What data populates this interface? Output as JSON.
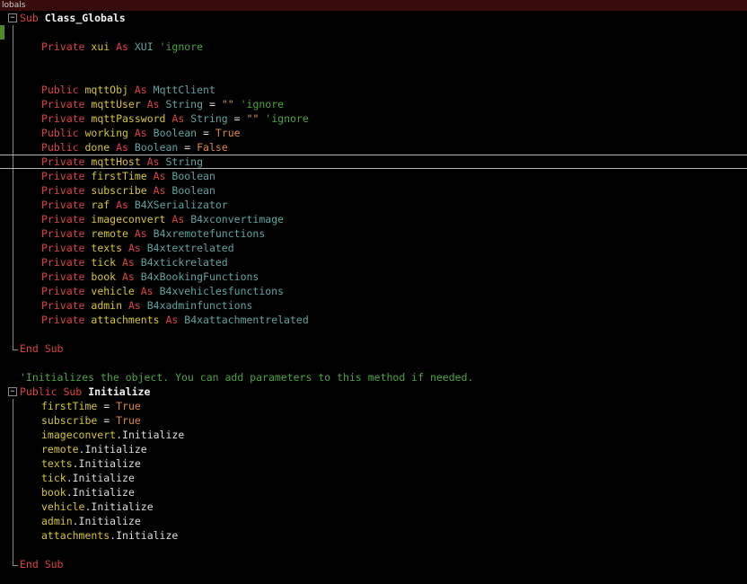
{
  "window": {
    "tab_label": "lobals"
  },
  "palette": {
    "bg": "#000000",
    "bar": "#3a0b0b",
    "bartext": "#cccccc",
    "kw": "#dd4242",
    "id": "#d6c42e",
    "type": "#5fa3a0",
    "cmt": "#4ea342",
    "str": "#d79a52",
    "val": "#d8873c",
    "txt": "#dcdcdc",
    "sub": "#f2f2f2",
    "guide": "#8a8a8a",
    "currentline": "#b5b5b5",
    "marker": "#4f8a26"
  },
  "icons": {
    "fold_collapse": "−"
  },
  "code": {
    "lines": [
      {
        "gutter": "fold",
        "indent": 0,
        "tokens": [
          [
            "kw",
            "Sub "
          ],
          [
            "sub",
            "Class_Globals"
          ]
        ]
      },
      {
        "gutter": "guide",
        "indent": 1,
        "marker": true,
        "tokens": []
      },
      {
        "gutter": "guide",
        "indent": 1,
        "tokens": [
          [
            "kw",
            "Private "
          ],
          [
            "id",
            "xui "
          ],
          [
            "kw",
            "As "
          ],
          [
            "type",
            "XUI "
          ],
          [
            "cmt",
            "'ignore"
          ]
        ]
      },
      {
        "gutter": "guide",
        "indent": 1,
        "tokens": []
      },
      {
        "gutter": "guide",
        "indent": 1,
        "tokens": []
      },
      {
        "gutter": "guide",
        "indent": 1,
        "tokens": [
          [
            "kw",
            "Public "
          ],
          [
            "id",
            "mqttObj "
          ],
          [
            "kw",
            "As "
          ],
          [
            "type",
            "MqttClient"
          ]
        ]
      },
      {
        "gutter": "guide",
        "indent": 1,
        "tokens": [
          [
            "kw",
            "Private "
          ],
          [
            "id",
            "mqttUser "
          ],
          [
            "kw",
            "As "
          ],
          [
            "type",
            "String "
          ],
          [
            "txt",
            "= "
          ],
          [
            "str",
            "\"\" "
          ],
          [
            "cmt",
            "'ignore"
          ]
        ]
      },
      {
        "gutter": "guide",
        "indent": 1,
        "tokens": [
          [
            "kw",
            "Private "
          ],
          [
            "id",
            "mqttPassword "
          ],
          [
            "kw",
            "As "
          ],
          [
            "type",
            "String "
          ],
          [
            "txt",
            "= "
          ],
          [
            "str",
            "\"\" "
          ],
          [
            "cmt",
            "'ignore"
          ]
        ]
      },
      {
        "gutter": "guide",
        "indent": 1,
        "tokens": [
          [
            "kw",
            "Public "
          ],
          [
            "id",
            "working "
          ],
          [
            "kw",
            "As "
          ],
          [
            "type",
            "Boolean "
          ],
          [
            "txt",
            "= "
          ],
          [
            "val",
            "True"
          ]
        ]
      },
      {
        "gutter": "guide",
        "indent": 1,
        "tokens": [
          [
            "kw",
            "Public "
          ],
          [
            "id",
            "done "
          ],
          [
            "kw",
            "As "
          ],
          [
            "type",
            "Boolean "
          ],
          [
            "txt",
            "= "
          ],
          [
            "val",
            "False"
          ]
        ]
      },
      {
        "gutter": "guide",
        "indent": 1,
        "current": true,
        "tokens": [
          [
            "kw",
            "Private "
          ],
          [
            "id",
            "mqttHost "
          ],
          [
            "kw",
            "As "
          ],
          [
            "type",
            "String"
          ]
        ]
      },
      {
        "gutter": "guide",
        "indent": 1,
        "tokens": [
          [
            "kw",
            "Private "
          ],
          [
            "id",
            "firstTime "
          ],
          [
            "kw",
            "As "
          ],
          [
            "type",
            "Boolean"
          ]
        ]
      },
      {
        "gutter": "guide",
        "indent": 1,
        "tokens": [
          [
            "kw",
            "Private "
          ],
          [
            "id",
            "subscribe "
          ],
          [
            "kw",
            "As "
          ],
          [
            "type",
            "Boolean"
          ]
        ]
      },
      {
        "gutter": "guide",
        "indent": 1,
        "tokens": [
          [
            "kw",
            "Private "
          ],
          [
            "id",
            "raf "
          ],
          [
            "kw",
            "As "
          ],
          [
            "type",
            "B4XSerializator"
          ]
        ]
      },
      {
        "gutter": "guide",
        "indent": 1,
        "tokens": [
          [
            "kw",
            "Private "
          ],
          [
            "id",
            "imageconvert "
          ],
          [
            "kw",
            "As "
          ],
          [
            "type",
            "B4xconvertimage"
          ]
        ]
      },
      {
        "gutter": "guide",
        "indent": 1,
        "tokens": [
          [
            "kw",
            "Private "
          ],
          [
            "id",
            "remote "
          ],
          [
            "kw",
            "As "
          ],
          [
            "type",
            "B4xremotefunctions"
          ]
        ]
      },
      {
        "gutter": "guide",
        "indent": 1,
        "tokens": [
          [
            "kw",
            "Private "
          ],
          [
            "id",
            "texts "
          ],
          [
            "kw",
            "As "
          ],
          [
            "type",
            "B4xtextrelated"
          ]
        ]
      },
      {
        "gutter": "guide",
        "indent": 1,
        "tokens": [
          [
            "kw",
            "Private "
          ],
          [
            "id",
            "tick "
          ],
          [
            "kw",
            "As "
          ],
          [
            "type",
            "B4xtickrelated"
          ]
        ]
      },
      {
        "gutter": "guide",
        "indent": 1,
        "tokens": [
          [
            "kw",
            "Private "
          ],
          [
            "id",
            "book "
          ],
          [
            "kw",
            "As "
          ],
          [
            "type",
            "B4xBookingFunctions"
          ]
        ]
      },
      {
        "gutter": "guide",
        "indent": 1,
        "tokens": [
          [
            "kw",
            "Private "
          ],
          [
            "id",
            "vehicle "
          ],
          [
            "kw",
            "As "
          ],
          [
            "type",
            "B4xvehiclesfunctions"
          ]
        ]
      },
      {
        "gutter": "guide",
        "indent": 1,
        "tokens": [
          [
            "kw",
            "Private "
          ],
          [
            "id",
            "admin "
          ],
          [
            "kw",
            "As "
          ],
          [
            "type",
            "B4xadminfunctions"
          ]
        ]
      },
      {
        "gutter": "guide",
        "indent": 1,
        "tokens": [
          [
            "kw",
            "Private "
          ],
          [
            "id",
            "attachments "
          ],
          [
            "kw",
            "As "
          ],
          [
            "type",
            "B4xattachmentrelated"
          ]
        ]
      },
      {
        "gutter": "guide",
        "indent": 1,
        "tokens": []
      },
      {
        "gutter": "end",
        "indent": 0,
        "tokens": [
          [
            "kw",
            "End Sub"
          ]
        ]
      },
      {
        "gutter": "",
        "indent": 0,
        "tokens": []
      },
      {
        "gutter": "",
        "indent": 0,
        "tokens": [
          [
            "cmt",
            "'Initializes the object. You can add parameters to this method if needed."
          ]
        ]
      },
      {
        "gutter": "fold",
        "indent": 0,
        "tokens": [
          [
            "kw",
            "Public Sub "
          ],
          [
            "sub",
            "Initialize"
          ]
        ]
      },
      {
        "gutter": "guide",
        "indent": 1,
        "tokens": [
          [
            "id",
            "firstTime "
          ],
          [
            "txt",
            "= "
          ],
          [
            "val",
            "True"
          ]
        ]
      },
      {
        "gutter": "guide",
        "indent": 1,
        "tokens": [
          [
            "id",
            "subscribe "
          ],
          [
            "txt",
            "= "
          ],
          [
            "val",
            "True"
          ]
        ]
      },
      {
        "gutter": "guide",
        "indent": 1,
        "tokens": [
          [
            "id",
            "imageconvert"
          ],
          [
            "txt",
            ".Initialize"
          ]
        ]
      },
      {
        "gutter": "guide",
        "indent": 1,
        "tokens": [
          [
            "id",
            "remote"
          ],
          [
            "txt",
            ".Initialize"
          ]
        ]
      },
      {
        "gutter": "guide",
        "indent": 1,
        "tokens": [
          [
            "id",
            "texts"
          ],
          [
            "txt",
            ".Initialize"
          ]
        ]
      },
      {
        "gutter": "guide",
        "indent": 1,
        "tokens": [
          [
            "id",
            "tick"
          ],
          [
            "txt",
            ".Initialize"
          ]
        ]
      },
      {
        "gutter": "guide",
        "indent": 1,
        "tokens": [
          [
            "id",
            "book"
          ],
          [
            "txt",
            ".Initialize"
          ]
        ]
      },
      {
        "gutter": "guide",
        "indent": 1,
        "tokens": [
          [
            "id",
            "vehicle"
          ],
          [
            "txt",
            ".Initialize"
          ]
        ]
      },
      {
        "gutter": "guide",
        "indent": 1,
        "tokens": [
          [
            "id",
            "admin"
          ],
          [
            "txt",
            ".Initialize"
          ]
        ]
      },
      {
        "gutter": "guide",
        "indent": 1,
        "tokens": [
          [
            "id",
            "attachments"
          ],
          [
            "txt",
            ".Initialize"
          ]
        ]
      },
      {
        "gutter": "guide",
        "indent": 1,
        "tokens": []
      },
      {
        "gutter": "end",
        "indent": 0,
        "tokens": [
          [
            "kw",
            "End Sub"
          ]
        ]
      },
      {
        "gutter": "",
        "indent": 0,
        "tokens": []
      }
    ]
  }
}
